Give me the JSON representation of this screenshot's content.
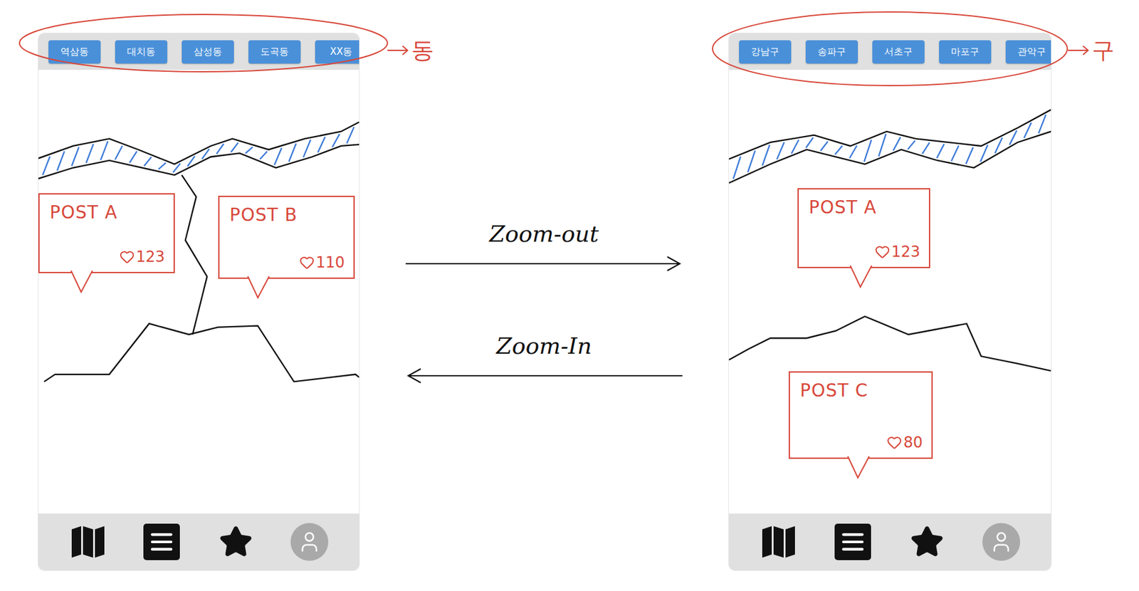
{
  "screens": [
    {
      "scale_label": "동",
      "region_tabs": [
        {
          "label": "역삼동",
          "selected": false
        },
        {
          "label": "대치동",
          "selected": false
        },
        {
          "label": "삼성동",
          "selected": false
        },
        {
          "label": "도곡동",
          "selected": false
        },
        {
          "label": "XX동",
          "selected": false
        }
      ],
      "posts": [
        {
          "title": "POST A",
          "likes": "123"
        },
        {
          "title": "POST B",
          "likes": "110"
        }
      ]
    },
    {
      "scale_label": "구",
      "region_tabs": [
        {
          "label": "강남구",
          "selected": false
        },
        {
          "label": "송파구",
          "selected": false
        },
        {
          "label": "서초구",
          "selected": false
        },
        {
          "label": "마포구",
          "selected": false
        },
        {
          "label": "관악구",
          "selected": false
        }
      ],
      "posts": [
        {
          "title": "POST A",
          "likes": "123"
        },
        {
          "title": "POST C",
          "likes": "80"
        }
      ]
    }
  ],
  "transitions": [
    {
      "label": "Zoom-out",
      "direction": "right"
    },
    {
      "label": "Zoom-In",
      "direction": "left"
    }
  ]
}
